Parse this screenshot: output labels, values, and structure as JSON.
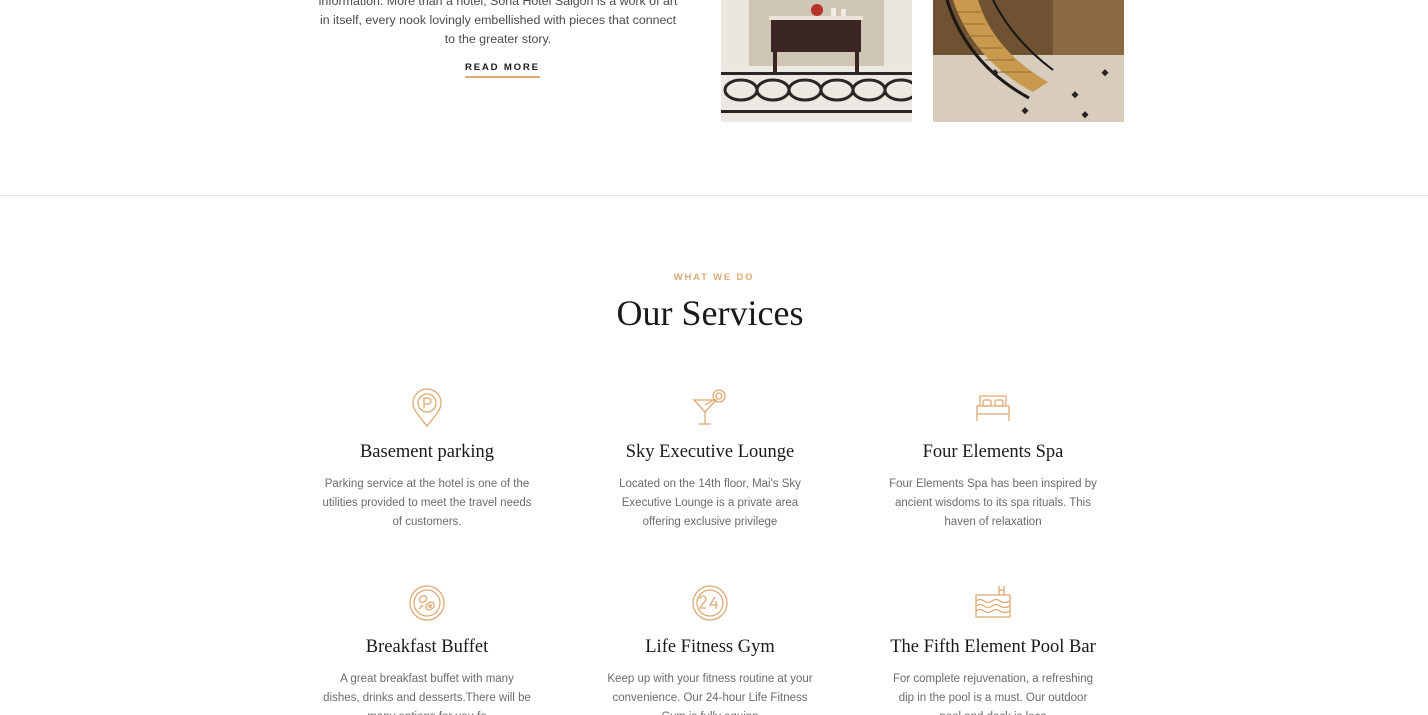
{
  "about": {
    "text": "information. More than a hotel, Sona Hotel Saigon is a work of art in itself, every nook lovingly embellished with pieces that connect to the greater story.",
    "read_more": "READ MORE"
  },
  "services": {
    "tag": "WHAT WE DO",
    "title": "Our Services",
    "items": [
      {
        "icon": "parking-pin-icon",
        "name": "Basement parking",
        "desc": "Parking service at the hotel is one of the utilities provided to meet the travel needs of customers."
      },
      {
        "icon": "cocktail-icon",
        "name": "Sky Executive Lounge",
        "desc": "Located on the 14th floor, Mai's Sky Executive Lounge is a private area offering exclusive privilege"
      },
      {
        "icon": "bed-icon",
        "name": "Four Elements Spa",
        "desc": "Four Elements Spa has been inspired by ancient wisdoms to its spa rituals. This haven of relaxation"
      },
      {
        "icon": "breakfast-plate-icon",
        "name": "Breakfast Buffet",
        "desc": "A great breakfast buffet with many dishes, drinks and desserts.There will be many options for you fo"
      },
      {
        "icon": "24-hour-icon",
        "name": "Life Fitness Gym",
        "desc": "Keep up with your fitness routine at your convenience. Our 24-hour Life Fitness Gym is fully equipp"
      },
      {
        "icon": "pool-icon",
        "name": "The Fifth Element Pool Bar",
        "desc": "For complete rejuvenation, a refreshing dip in the pool is a must. Our outdoor pool and deck is loca"
      }
    ]
  },
  "colors": {
    "accent": "#dfa974",
    "heading": "#19191a",
    "body_text": "#6b6b6b",
    "divider": "#e5e5e5"
  }
}
